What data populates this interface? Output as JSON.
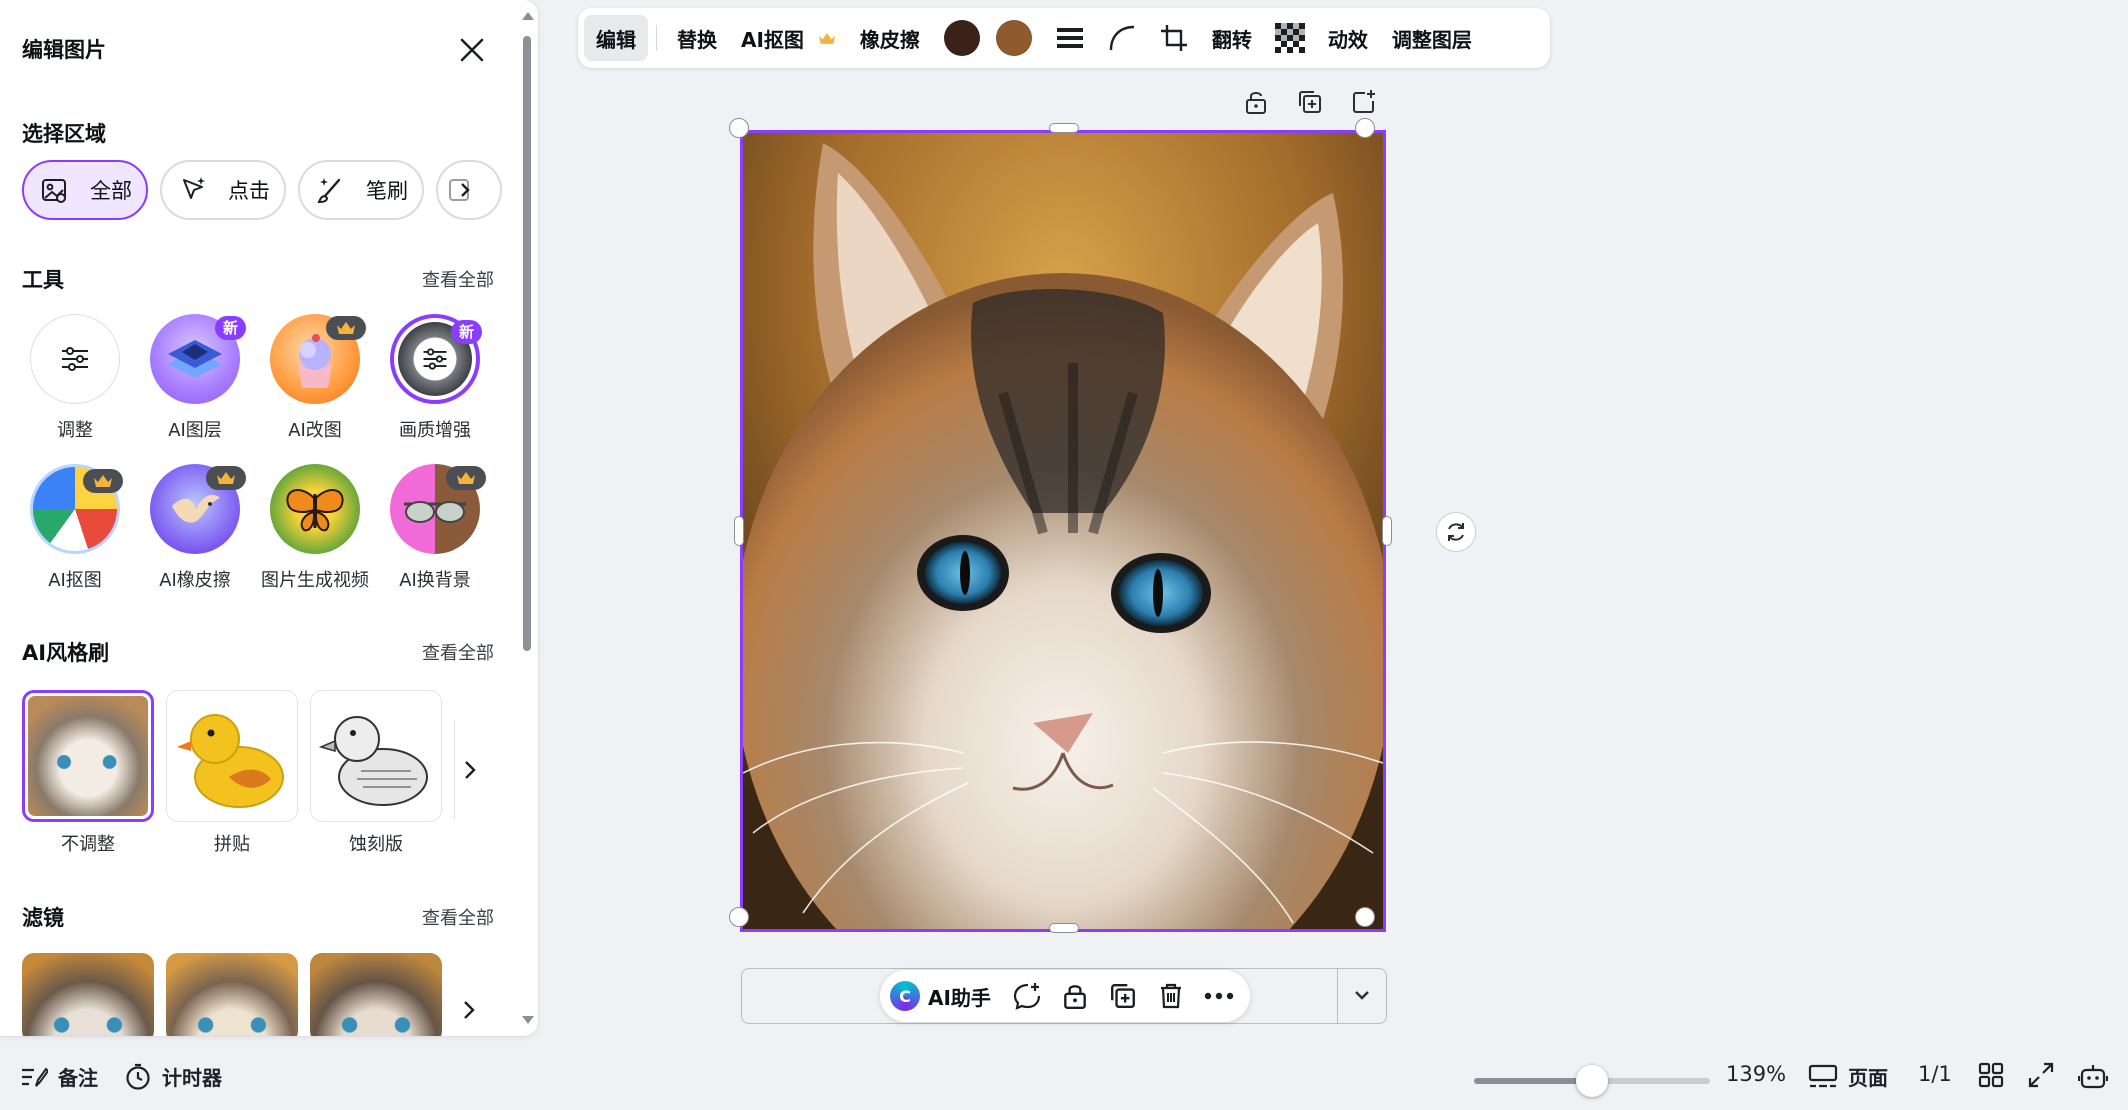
{
  "panel": {
    "title": "编辑图片",
    "select_area": {
      "title": "选择区域",
      "chips": [
        {
          "label": "全部",
          "icon": "image-select-icon",
          "active": true
        },
        {
          "label": "点击",
          "icon": "click-sparkle-icon",
          "active": false
        },
        {
          "label": "笔刷",
          "icon": "brush-sparkle-icon",
          "active": false
        }
      ]
    },
    "tools": {
      "title": "工具",
      "see_all": "查看全部",
      "items": [
        {
          "label": "调整",
          "icon": "sliders-icon",
          "badge": ""
        },
        {
          "label": "AI图层",
          "icon": "layers-icon",
          "badge": "新"
        },
        {
          "label": "AI改图",
          "icon": "cupcake-icon",
          "badge": "crown"
        },
        {
          "label": "画质增强",
          "icon": "enhance-icon",
          "badge": "新"
        },
        {
          "label": "AI抠图",
          "icon": "beach-ball-icon",
          "badge": "crown"
        },
        {
          "label": "AI橡皮擦",
          "icon": "bird-icon",
          "badge": "crown"
        },
        {
          "label": "图片生成视频",
          "icon": "butterfly-icon",
          "badge": ""
        },
        {
          "label": "AI换背景",
          "icon": "sunglasses-icon",
          "badge": "crown"
        }
      ]
    },
    "ai_style": {
      "title": "AI风格刷",
      "see_all": "查看全部",
      "items": [
        {
          "label": "不调整"
        },
        {
          "label": "拼贴"
        },
        {
          "label": "蚀刻版"
        }
      ]
    },
    "filters": {
      "title": "滤镜",
      "see_all": "查看全部"
    }
  },
  "toolbar": {
    "items": [
      "编辑",
      "替换",
      "AI抠图",
      "橡皮擦",
      "翻转",
      "动效",
      "调整图层"
    ],
    "swatch_colors": [
      "#3b2218",
      "#8e5a2e"
    ],
    "accent": "#8b3dff"
  },
  "float_menu": {
    "ai_label": "AI助手"
  },
  "footer": {
    "notes": "备注",
    "timer": "计时器",
    "zoom": "139%",
    "zoom_fraction": 0.5,
    "pages_label": "页面",
    "page_count": "1/1"
  }
}
